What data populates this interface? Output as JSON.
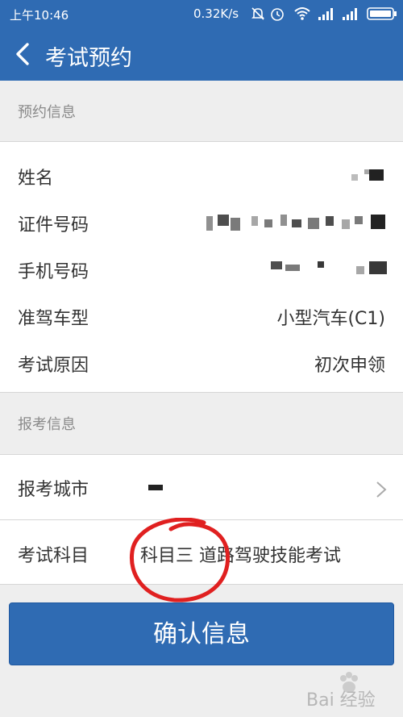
{
  "status": {
    "time": "上午10:46",
    "speed": "0.32K/s"
  },
  "header": {
    "title": "考试预约"
  },
  "booking_section": {
    "label": "预约信息",
    "rows": [
      {
        "label": "姓名",
        "value": ""
      },
      {
        "label": "证件号码",
        "value": ""
      },
      {
        "label": "手机号码",
        "value": ""
      },
      {
        "label": "准驾车型",
        "value": "小型汽车(C1)"
      },
      {
        "label": "考试原因",
        "value": "初次申领"
      }
    ]
  },
  "exam_section": {
    "label": "报考信息",
    "city_label": "报考城市",
    "subject_label": "考试科目",
    "subject_value": "科目三 道路驾驶技能考试"
  },
  "confirm_button": "确认信息",
  "watermark": "Bai 经验",
  "colors": {
    "primary": "#2f6bb3",
    "background": "#eeeeee",
    "annotation": "#e02020"
  }
}
